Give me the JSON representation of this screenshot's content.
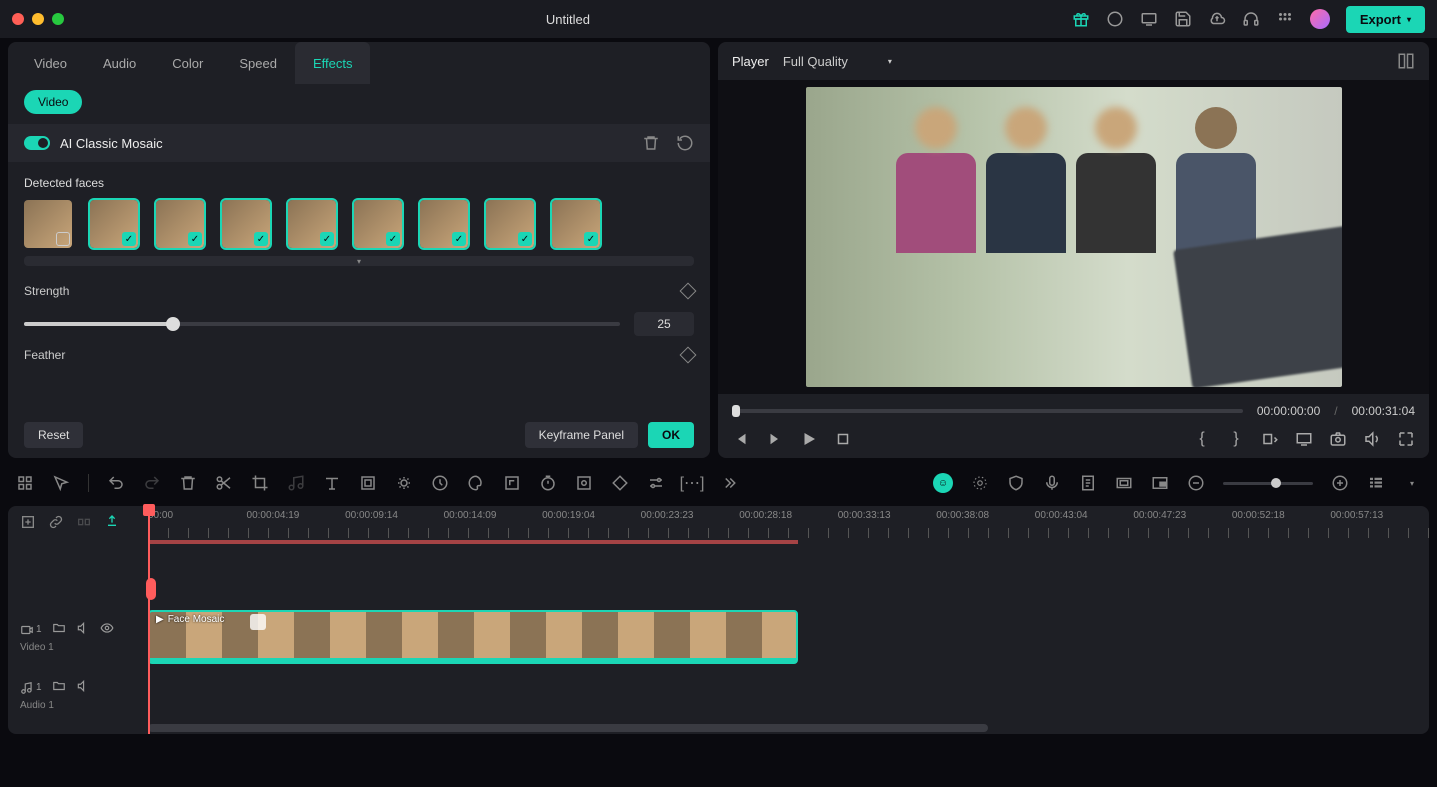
{
  "titlebar": {
    "title": "Untitled",
    "export_label": "Export"
  },
  "left_panel": {
    "tabs": [
      {
        "label": "Video",
        "active": false
      },
      {
        "label": "Audio",
        "active": false
      },
      {
        "label": "Color",
        "active": false
      },
      {
        "label": "Speed",
        "active": false
      },
      {
        "label": "Effects",
        "active": true
      }
    ],
    "pill": "Video",
    "effect_name": "AI Classic Mosaic",
    "detected_label": "Detected faces",
    "faces": [
      {
        "selected": false,
        "checked": false
      },
      {
        "selected": true,
        "checked": true
      },
      {
        "selected": true,
        "checked": true
      },
      {
        "selected": true,
        "checked": true
      },
      {
        "selected": true,
        "checked": true
      },
      {
        "selected": true,
        "checked": true
      },
      {
        "selected": true,
        "checked": true
      },
      {
        "selected": true,
        "checked": true
      },
      {
        "selected": true,
        "checked": true
      }
    ],
    "strength": {
      "label": "Strength",
      "value": 25,
      "percent": 25
    },
    "feather": {
      "label": "Feather"
    },
    "reset_label": "Reset",
    "keyframe_label": "Keyframe Panel",
    "ok_label": "OK"
  },
  "player": {
    "label": "Player",
    "quality": "Full Quality",
    "current_time": "00:00:00:00",
    "total_time": "00:00:31:04"
  },
  "timeline": {
    "labels": [
      "00:00",
      "00:00:04:19",
      "00:00:09:14",
      "00:00:14:09",
      "00:00:19:04",
      "00:00:23:23",
      "00:00:28:18",
      "00:00:33:13",
      "00:00:38:08",
      "00:00:43:04",
      "00:00:47:23",
      "00:00:52:18",
      "00:00:57:13"
    ],
    "tracks": {
      "video": {
        "name": "Video 1",
        "index": "1",
        "clip_label": "Face Mosaic"
      },
      "audio": {
        "name": "Audio 1",
        "index": "1"
      }
    }
  }
}
